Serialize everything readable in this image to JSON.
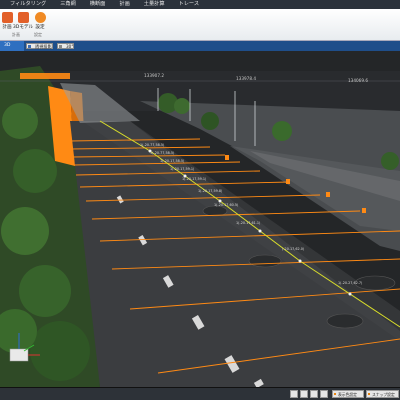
{
  "menu": [
    "フィルタリング",
    "三角網",
    "横断面",
    "計画",
    "土量計算",
    "トレース"
  ],
  "ribbon": {
    "buttons": [
      {
        "label": "計画",
        "icon": "plan-icon",
        "color": "#e2602a"
      },
      {
        "label": "3Dモデル",
        "icon": "model-3d-icon",
        "color": "#e2602a"
      },
      {
        "label": "設定",
        "icon": "gear-icon",
        "color": "#f08a24"
      }
    ],
    "group_labels": [
      "計画",
      "設定"
    ]
  },
  "view_tab": "3D",
  "toolbar": {
    "mode": "透視投影",
    "angle": "30°"
  },
  "coordinates": [
    "133907.2",
    "133978.4",
    "134069.6"
  ],
  "cross_section_labels": [
    "1(-20.77,58.5)",
    "1(-20.77,58.5)",
    "1(-20.17,58.5)",
    "1(-20.17,59.1)",
    "1(-20.17,59.1)",
    "1(-20.17,59.8)",
    "1(-20.17,60.5)",
    "1(-20.17,61.1)",
    "(-20.17,62.0)",
    "1(-20.27,62.7)"
  ],
  "statusbar": {
    "buttons": [
      "表示色設定",
      "スナップ設定"
    ]
  },
  "colors": {
    "accent_orange": "#ff8a14",
    "center_line": "#d7dc2b",
    "road": "#3b3d40",
    "sky": "#232527",
    "vegetation": "#3c6b2d"
  }
}
